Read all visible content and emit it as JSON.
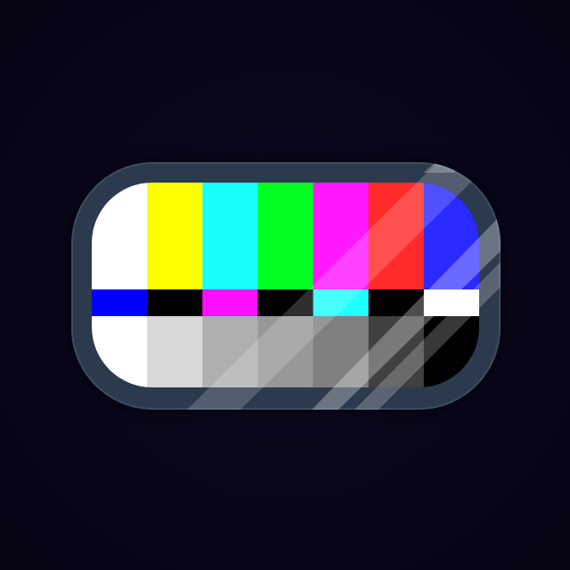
{
  "image": {
    "subject": "tv-color-bars-icon",
    "background_color": "#080616",
    "frame_color": "#2c3a4d"
  },
  "color_bars": {
    "top_row": [
      "#ffffff",
      "#ffff00",
      "#18ffff",
      "#00ff20",
      "#ff18ff",
      "#ff2a2a",
      "#2a2aff"
    ],
    "middle_row": [
      "#0000ff",
      "#000000",
      "#ff10ff",
      "#000000",
      "#20ffff",
      "#000000",
      "#ffffff"
    ],
    "bottom_row": [
      "#ffffff",
      "#d8d8d8",
      "#b0b0b0",
      "#989898",
      "#808080",
      "#404040",
      "#000000"
    ]
  }
}
